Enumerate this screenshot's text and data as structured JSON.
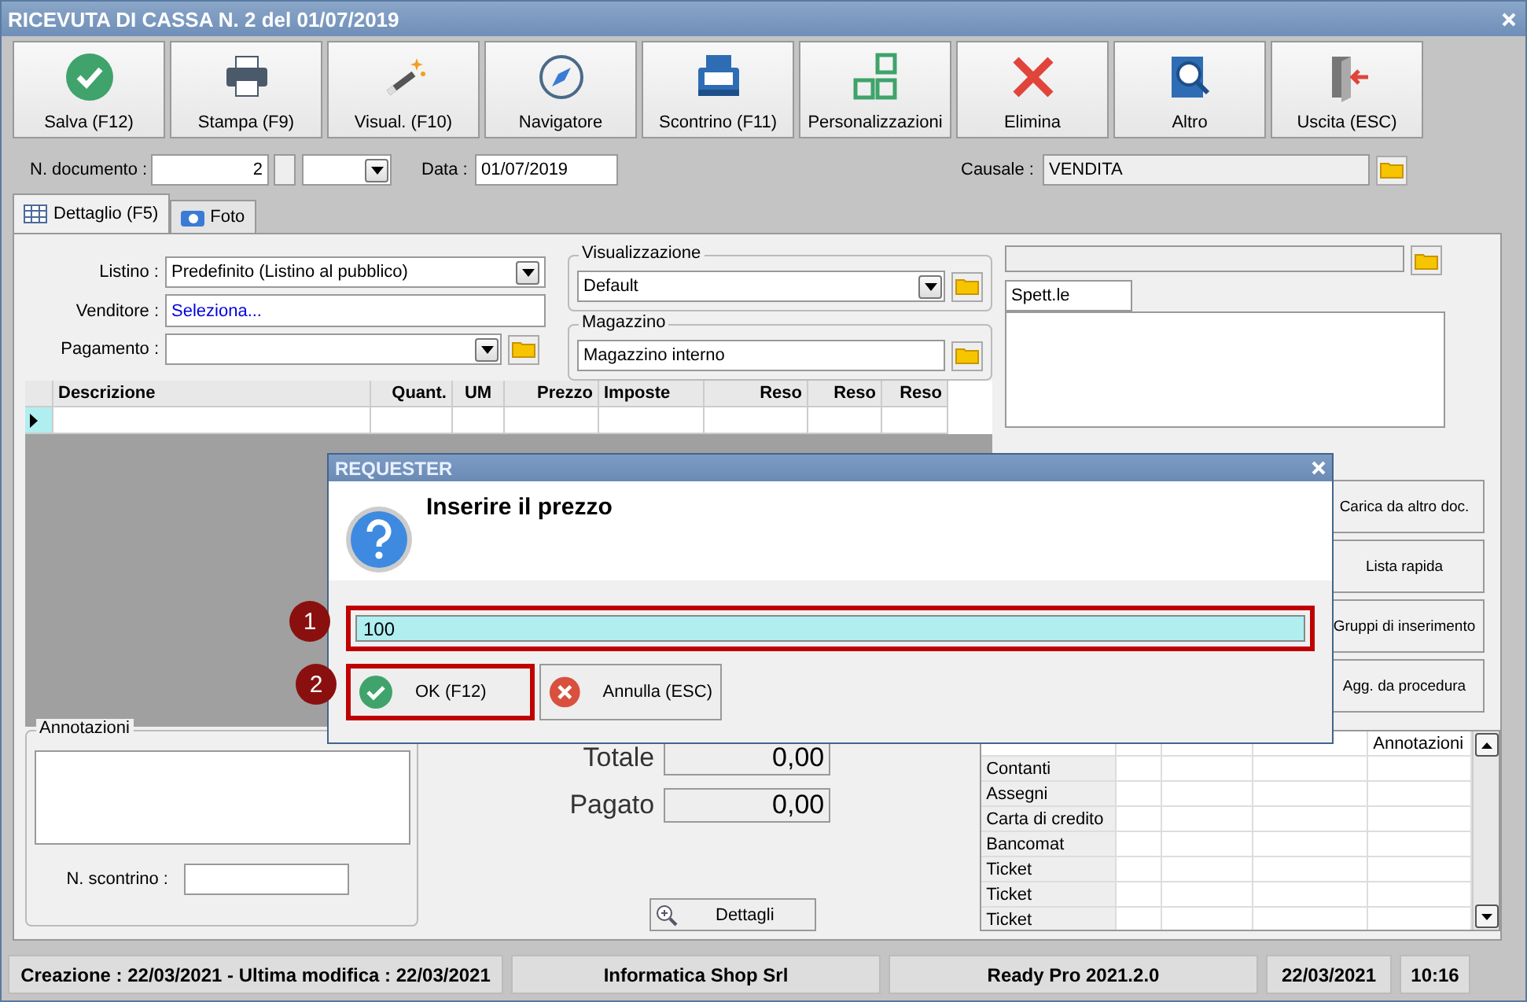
{
  "window": {
    "title": "RICEVUTA DI CASSA N. 2 del 01/07/2019"
  },
  "toolbar": [
    {
      "label": "Salva (F12)",
      "kind": "check"
    },
    {
      "label": "Stampa (F9)",
      "kind": "printer"
    },
    {
      "label": "Visual. (F10)",
      "kind": "wand"
    },
    {
      "label": "Navigatore",
      "kind": "compass"
    },
    {
      "label": "Scontrino (F11)",
      "kind": "register"
    },
    {
      "label": "Personalizzazioni",
      "kind": "squares"
    },
    {
      "label": "Elimina",
      "kind": "cross"
    },
    {
      "label": "Altro",
      "kind": "search"
    },
    {
      "label": "Uscita (ESC)",
      "kind": "exit"
    }
  ],
  "document": {
    "number_label": "N. documento :",
    "number": "2",
    "date_label": "Data :",
    "date": "01/07/2019",
    "causale_label": "Causale :",
    "causale": "VENDITA"
  },
  "tabs": [
    {
      "label": "Dettaglio (F5)",
      "kind": "table",
      "selected": true
    },
    {
      "label": "Foto",
      "kind": "camera",
      "selected": false
    }
  ],
  "form": {
    "listino_label": "Listino :",
    "listino": "Predefinito (Listino al pubblico)",
    "venditore_label": "Venditore :",
    "venditore": "Seleziona...",
    "pagamento_label": "Pagamento :"
  },
  "visualizzazione": {
    "title": "Visualizzazione",
    "value": "Default"
  },
  "magazzino": {
    "title": "Magazzino",
    "value": "Magazzino interno"
  },
  "customer": {
    "salutation": "Spett.le"
  },
  "grid": {
    "columns": [
      "Descrizione",
      "Quant.",
      "UM",
      "Prezzo",
      "Imposte",
      "Reso",
      "Reso",
      "Reso"
    ]
  },
  "side_buttons": [
    "Carica da altro doc.",
    "Lista rapida",
    "Gruppi di inserimento",
    "Agg. da procedura"
  ],
  "annotations": {
    "title": "Annotazioni",
    "receipt_label": "N. scontrino :"
  },
  "totals": [
    {
      "label": "Totale",
      "value": "0,00"
    },
    {
      "label": "Pagato",
      "value": "0,00"
    }
  ],
  "details_button": "Dettagli",
  "payments": {
    "annotations_header": "Annotazioni",
    "rows": [
      "Contanti",
      "Assegni",
      "Carta di credito",
      "Bancomat",
      "Ticket",
      "Ticket",
      "Ticket"
    ]
  },
  "status_bar": [
    "Creazione : 22/03/2021 - Ultima modifica : 22/03/2021",
    "Informatica Shop Srl",
    "Ready Pro 2021.2.0",
    "22/03/2021",
    "10:16"
  ],
  "dialog": {
    "title": "REQUESTER",
    "message": "Inserire il prezzo",
    "value": "100",
    "highlighted": true,
    "buttons": [
      {
        "label": "OK (F12)",
        "kind": "ok",
        "highlighted": true
      },
      {
        "label": "Annulla (ESC)",
        "kind": "cancel",
        "highlighted": false
      }
    ]
  },
  "callouts": [
    "1",
    "2"
  ]
}
